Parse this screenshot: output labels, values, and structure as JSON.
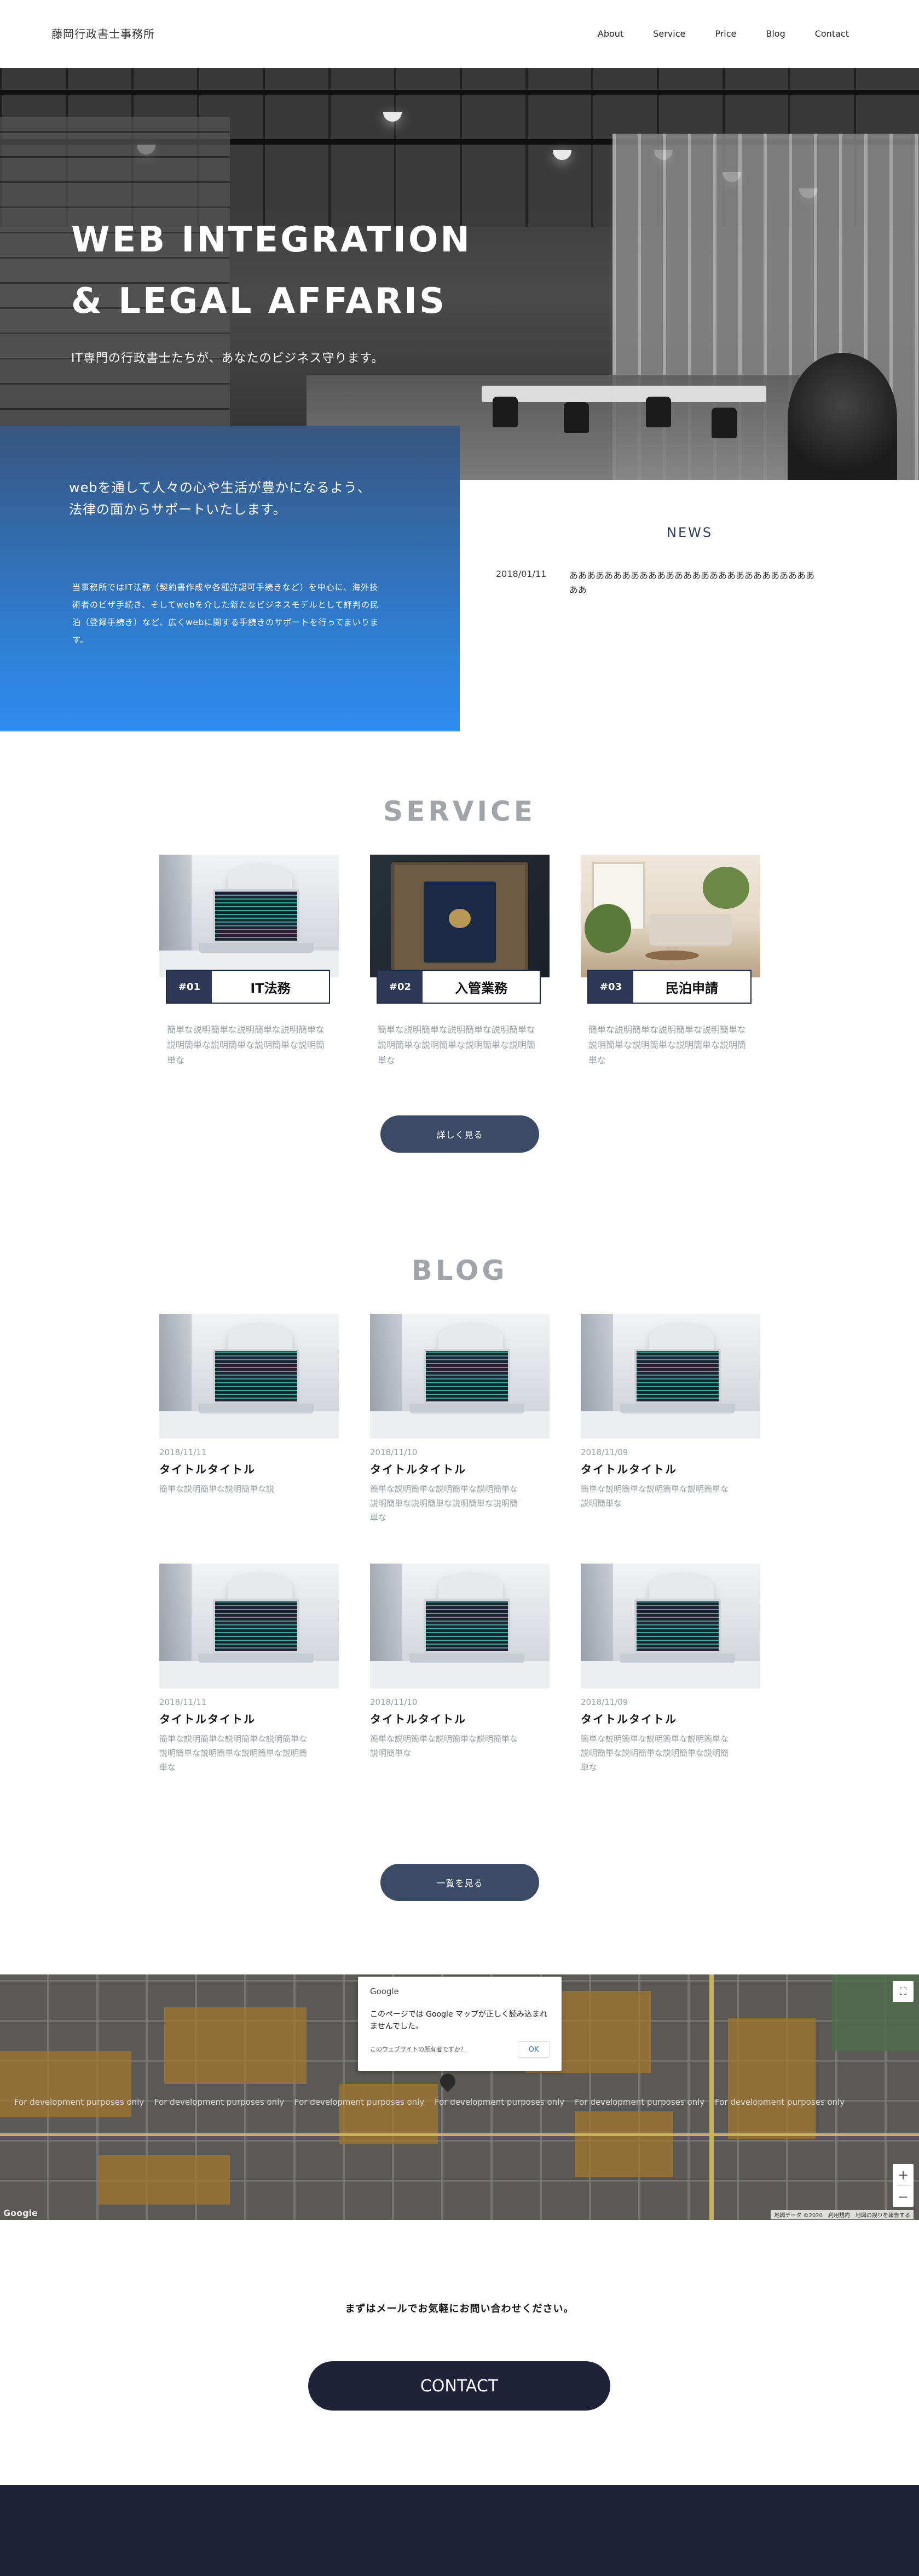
{
  "header": {
    "logo": "藤岡行政書士事務所",
    "nav": [
      "About",
      "Service",
      "Price",
      "Blog",
      "Contact"
    ]
  },
  "hero": {
    "title_line1": "WEB INTEGRATION",
    "title_line2": "& LEGAL AFFARIS",
    "subtitle": "IT専門の行政書士たちが、あなたのビジネス守ります。"
  },
  "about": {
    "lead_line1": "webを通して人々の心や生活が豊かになるよう、",
    "lead_line2": "法律の面からサポートいたします。",
    "text": "当事務所ではIT法務（契約書作成や各種許認可手続きなど）を中心に、海外技術者のビザ手続き、そしてwebを介した新たなビジネスモデルとして評判の民泊（登録手続き）など、広くwebに関する手続きのサポートを行ってまいります。"
  },
  "news": {
    "title": "NEWS",
    "items": [
      {
        "date": "2018/01/11",
        "text": "ああああああああああああああああああああああああああああああ"
      }
    ]
  },
  "service": {
    "title": "SERVICE",
    "items": [
      {
        "num": "#01",
        "name": "IT法務",
        "desc": "簡単な説明簡単な説明簡単な説明簡単な説明簡単な説明簡単な説明簡単な説明簡単な"
      },
      {
        "num": "#02",
        "name": "入管業務",
        "desc": "簡単な説明簡単な説明簡単な説明簡単な説明簡単な説明簡単な説明簡単な説明簡単な"
      },
      {
        "num": "#03",
        "name": "民泊申請",
        "desc": "簡単な説明簡単な説明簡単な説明簡単な説明簡単な説明簡単な説明簡単な説明簡単な"
      }
    ],
    "button": "詳しく見る"
  },
  "blog": {
    "title": "BLOG",
    "items": [
      {
        "date": "2018/11/11",
        "title": "タイトルタイトル",
        "desc": "簡単な説明簡単な説明簡単な説"
      },
      {
        "date": "2018/11/10",
        "title": "タイトルタイトル",
        "desc": "簡単な説明簡単な説明簡単な説明簡単な説明簡単な説明簡単な説明簡単な説明簡単な"
      },
      {
        "date": "2018/11/09",
        "title": "タイトルタイトル",
        "desc": "簡単な説明簡単な説明簡単な説明簡単な説明簡単な"
      },
      {
        "date": "2018/11/11",
        "title": "タイトルタイトル",
        "desc": "簡単な説明簡単な説明簡単な説明簡単な説明簡単な説明簡単な説明簡単な説明簡単な"
      },
      {
        "date": "2018/11/10",
        "title": "タイトルタイトル",
        "desc": "簡単な説明簡単な説明簡単な説明簡単な説明簡単な"
      },
      {
        "date": "2018/11/09",
        "title": "タイトルタイトル",
        "desc": "簡単な説明簡単な説明簡単な説明簡単な説明簡単な説明簡単な説明簡単な説明簡単な"
      }
    ],
    "button": "一覧を見る"
  },
  "map": {
    "dev_text": "For development purposes only",
    "dialog_brand": "Google",
    "dialog_text": "このページでは Google マップが正しく読み込まれませんでした。",
    "dialog_link": "このウェブサイトの所有者ですか？",
    "dialog_ok": "OK",
    "google_logo": "Google",
    "terms": "地図データ ©2020　利用規約　地図の誤りを報告する",
    "fullscreen_icon": "fullscreen-icon",
    "zoom_in": "+",
    "zoom_out": "−"
  },
  "contact": {
    "lead": "まずはメールでお気軽にお問い合わせください。",
    "button": "CONTACT"
  },
  "colors": {
    "primary_dark": "#1f2239",
    "button": "#3b4b66",
    "about_gradient_top": "#37557f",
    "about_gradient_bottom": "#2f8cf0",
    "heading_gray": "#a1a5aa"
  }
}
